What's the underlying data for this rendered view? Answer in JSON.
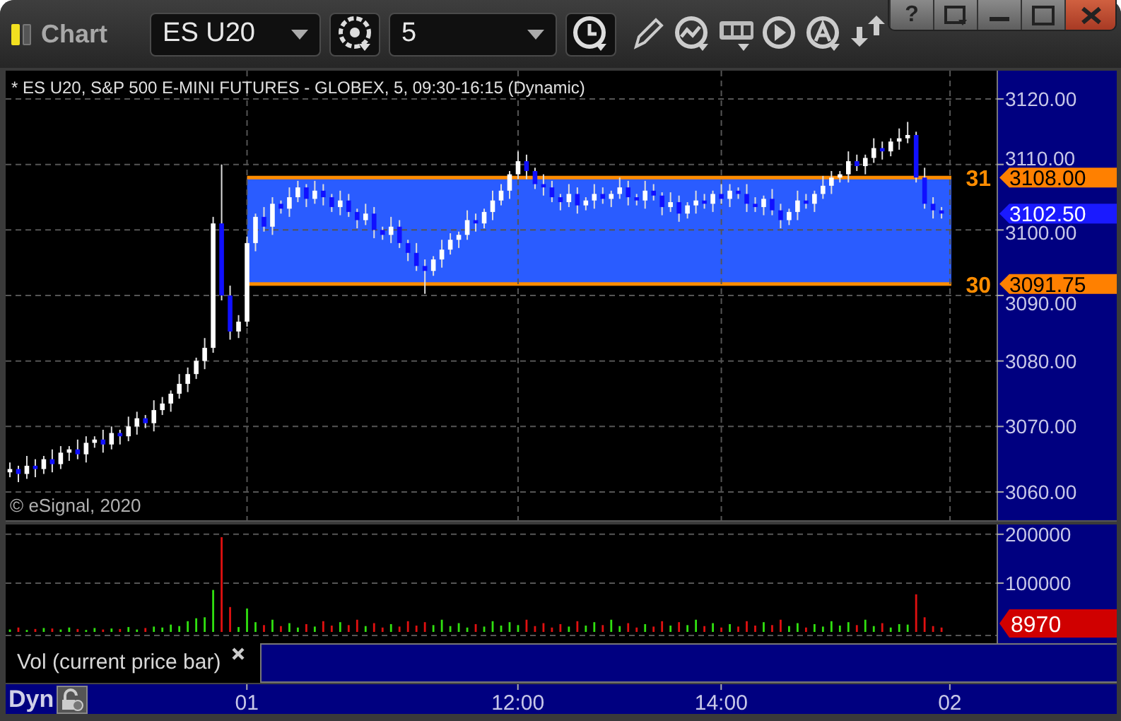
{
  "window": {
    "title": "Chart",
    "help_button": "?"
  },
  "toolbar": {
    "symbol": "ES U20",
    "interval": "5"
  },
  "price_pane": {
    "legend": "* ES U20, S&P 500 E-MINI FUTURES - GLOBEX, 5, 09:30-16:15 (Dynamic)",
    "copyright": "© eSignal, 2020",
    "band": {
      "upper_label": "31",
      "upper_price": "3108.00",
      "lower_label": "30",
      "lower_price": "3091.75"
    },
    "last_price": "3102.50",
    "chart_data": {
      "type": "candlestick",
      "grid": true,
      "categories": [
        null,
        null,
        null,
        null,
        null,
        null,
        null,
        null,
        null,
        null,
        null,
        null,
        null,
        null,
        null,
        null,
        null,
        null,
        null,
        null,
        null,
        null,
        null,
        null,
        null,
        null,
        null,
        null,
        null,
        null,
        null,
        null,
        null,
        null,
        null,
        null,
        null,
        null,
        null,
        null,
        null,
        null,
        null,
        null,
        null,
        null,
        null,
        null,
        null,
        null,
        null,
        null,
        null,
        null,
        null,
        null,
        null,
        null,
        null,
        null,
        null,
        null,
        null,
        null,
        null,
        null,
        null,
        null,
        null,
        null,
        null,
        null,
        null,
        null,
        null,
        null,
        null,
        null,
        null,
        null,
        null,
        null,
        null,
        null,
        null,
        null,
        null,
        null,
        null,
        null,
        null,
        null,
        null,
        null,
        null,
        null,
        null,
        null,
        null,
        null,
        null,
        null,
        null,
        null,
        null,
        null,
        null,
        null,
        null,
        null,
        null,
        null,
        null,
        null,
        null,
        null,
        null
      ],
      "ohlc": [
        [
          3063,
          3064.5,
          3062.25,
          3063.5
        ],
        [
          3063.5,
          3064,
          3061.5,
          3062.75
        ],
        [
          3062.75,
          3065.5,
          3062,
          3064
        ],
        [
          3064,
          3065,
          3062.25,
          3063.5
        ],
        [
          3063.5,
          3065.5,
          3062.75,
          3065
        ],
        [
          3065,
          3066.5,
          3063,
          3064.25
        ],
        [
          3064.25,
          3067,
          3063.5,
          3066
        ],
        [
          3066,
          3067,
          3064.75,
          3066.5
        ],
        [
          3066.5,
          3068,
          3065,
          3065.75
        ],
        [
          3065.75,
          3068.5,
          3064.5,
          3067.5
        ],
        [
          3067.5,
          3068.5,
          3066.75,
          3068
        ],
        [
          3068,
          3069.5,
          3066,
          3067.25
        ],
        [
          3067.25,
          3070,
          3066.5,
          3069
        ],
        [
          3069,
          3069.5,
          3067.25,
          3068.5
        ],
        [
          3068.5,
          3071.5,
          3067.75,
          3070
        ],
        [
          3070,
          3072.25,
          3068.75,
          3071.25
        ],
        [
          3071.25,
          3071.75,
          3069.75,
          3070.5
        ],
        [
          3070.5,
          3074,
          3069.25,
          3072.5
        ],
        [
          3072.5,
          3074.5,
          3071.75,
          3073.5
        ],
        [
          3073.5,
          3075.5,
          3072.25,
          3075
        ],
        [
          3075,
          3078,
          3074.25,
          3076.5
        ],
        [
          3076.5,
          3079,
          3075.25,
          3078
        ],
        [
          3078,
          3080.5,
          3077.25,
          3080
        ],
        [
          3080,
          3083.5,
          3078.75,
          3082
        ],
        [
          3082,
          3102,
          3081.25,
          3101
        ],
        [
          3101,
          3110,
          3089.25,
          3090
        ],
        [
          3090,
          3091.5,
          3083.25,
          3084.5
        ],
        [
          3084.5,
          3087,
          3083.5,
          3086
        ],
        [
          3086,
          3099,
          3085.25,
          3098
        ],
        [
          3098,
          3102.5,
          3096.75,
          3102
        ],
        [
          3102,
          3103.5,
          3099.75,
          3100.5
        ],
        [
          3100.5,
          3105,
          3099.25,
          3104
        ],
        [
          3104,
          3104.5,
          3102.5,
          3103.25
        ],
        [
          3103.25,
          3106.5,
          3102,
          3105
        ],
        [
          3105,
          3107.5,
          3104.25,
          3106.5
        ],
        [
          3106.5,
          3107,
          3103.5,
          3104.75
        ],
        [
          3104.75,
          3107.5,
          3104,
          3106
        ],
        [
          3106,
          3107,
          3103.75,
          3105
        ],
        [
          3105,
          3105.5,
          3102.75,
          3103.5
        ],
        [
          3103.5,
          3106,
          3102.25,
          3104.5
        ],
        [
          3104.5,
          3105.5,
          3102,
          3102.75
        ],
        [
          3102.75,
          3103.25,
          3100.25,
          3101.5
        ],
        [
          3101.5,
          3104,
          3100.75,
          3102.5
        ],
        [
          3102.5,
          3103.5,
          3098.75,
          3100
        ],
        [
          3100,
          3100.5,
          3098.5,
          3099.25
        ],
        [
          3099.25,
          3102,
          3098,
          3100.5
        ],
        [
          3100.5,
          3101.5,
          3097.25,
          3098
        ],
        [
          3098,
          3098.5,
          3095.25,
          3096.5
        ],
        [
          3096.5,
          3098,
          3093.75,
          3094.5
        ],
        [
          3094.5,
          3095.5,
          3090.25,
          3093.75
        ],
        [
          3093.75,
          3096,
          3093,
          3095.5
        ],
        [
          3095.5,
          3098.5,
          3094.25,
          3097
        ],
        [
          3097,
          3099.5,
          3096.25,
          3098.5
        ],
        [
          3098.5,
          3099.75,
          3097.25,
          3099.25
        ],
        [
          3099.25,
          3103,
          3098.5,
          3101.5
        ],
        [
          3101.5,
          3102.5,
          3099.75,
          3101
        ],
        [
          3101,
          3103.25,
          3100.25,
          3102.75
        ],
        [
          3102.75,
          3106,
          3101.5,
          3104.5
        ],
        [
          3104.5,
          3107,
          3103.75,
          3106
        ],
        [
          3106,
          3109,
          3104.75,
          3108.5
        ],
        [
          3108.5,
          3112,
          3107.75,
          3110.5
        ],
        [
          3110.5,
          3111.5,
          3107.75,
          3109
        ],
        [
          3109,
          3109.5,
          3106.25,
          3107
        ],
        [
          3107,
          3108.5,
          3105.25,
          3106.5
        ],
        [
          3106.5,
          3107.5,
          3104.25,
          3105
        ],
        [
          3105,
          3105.5,
          3103,
          3104.25
        ],
        [
          3104.25,
          3107,
          3103.5,
          3105.5
        ],
        [
          3105.5,
          3106.5,
          3102.5,
          3103.75
        ],
        [
          3103.75,
          3105,
          3103,
          3104.5
        ],
        [
          3104.5,
          3107,
          3103.25,
          3105.5
        ],
        [
          3105.5,
          3106.5,
          3104,
          3104.75
        ],
        [
          3104.75,
          3106,
          3103.5,
          3105.5
        ],
        [
          3105.5,
          3108,
          3104.75,
          3106.5
        ],
        [
          3106.5,
          3107.5,
          3103.75,
          3105
        ],
        [
          3105,
          3105.5,
          3103.75,
          3104.5
        ],
        [
          3104.5,
          3107.5,
          3103.25,
          3106
        ],
        [
          3106,
          3107,
          3104.5,
          3105.25
        ],
        [
          3105.25,
          3105.75,
          3102.25,
          3103.5
        ],
        [
          3103.5,
          3105.75,
          3102.75,
          3104.25
        ],
        [
          3104.25,
          3105.25,
          3101.25,
          3102.5
        ],
        [
          3102.5,
          3104.25,
          3101.75,
          3103.75
        ],
        [
          3103.75,
          3106,
          3102.5,
          3104.5
        ],
        [
          3104.5,
          3105.5,
          3103.25,
          3104
        ],
        [
          3104,
          3106,
          3102.75,
          3105.5
        ],
        [
          3105.5,
          3107,
          3104,
          3104.75
        ],
        [
          3104.75,
          3107,
          3103.5,
          3106
        ],
        [
          3106,
          3106.5,
          3104.75,
          3105.5
        ],
        [
          3105.5,
          3107,
          3102.75,
          3104
        ],
        [
          3104,
          3105,
          3102.75,
          3103.5
        ],
        [
          3103.5,
          3105.25,
          3102.25,
          3104.75
        ],
        [
          3104.75,
          3106.25,
          3102.25,
          3103
        ],
        [
          3103,
          3104,
          3100.25,
          3101.5
        ],
        [
          3101.5,
          3103.25,
          3100.75,
          3102.75
        ],
        [
          3102.75,
          3106,
          3101.5,
          3104.5
        ],
        [
          3104.5,
          3105.5,
          3103.25,
          3104
        ],
        [
          3104,
          3106,
          3102.75,
          3105.5
        ],
        [
          3105.5,
          3108.25,
          3104.75,
          3106.75
        ],
        [
          3106.75,
          3109,
          3105.5,
          3108
        ],
        [
          3108,
          3109,
          3107.25,
          3108.5
        ],
        [
          3108.5,
          3112,
          3107.25,
          3110.5
        ],
        [
          3110.5,
          3111.5,
          3109,
          3109.75
        ],
        [
          3109.75,
          3111.5,
          3108.5,
          3111
        ],
        [
          3111,
          3114,
          3110.25,
          3112.5
        ],
        [
          3112.5,
          3113.5,
          3110.75,
          3112
        ],
        [
          3112,
          3114,
          3111.25,
          3113.5
        ],
        [
          3113.5,
          3115.5,
          3112.25,
          3114
        ],
        [
          3114,
          3116.5,
          3113.25,
          3114.5
        ],
        [
          3114.5,
          3115,
          3107.25,
          3108
        ],
        [
          3108,
          3109.5,
          3103.25,
          3104
        ],
        [
          3104,
          3105,
          3101.75,
          3103
        ],
        [
          3103,
          3103.5,
          3101.75,
          3102.5
        ],
        null,
        null,
        null,
        null,
        null,
        null
      ],
      "ylim": [
        3055.68,
        3124.32
      ],
      "yticks": [
        {
          "value": 3120,
          "label": "3120.00"
        },
        {
          "value": 3110,
          "label": "3110.00"
        },
        {
          "value": 3100,
          "label": "3100.00"
        },
        {
          "value": 3090,
          "label": "3090.00"
        },
        {
          "value": 3080,
          "label": "3080.00"
        },
        {
          "value": 3070,
          "label": "3070.00"
        },
        {
          "value": 3060,
          "label": "3060.00"
        }
      ]
    }
  },
  "volume_pane": {
    "study": "Vol (current price bar)",
    "last_volume": "8970",
    "chart_data": {
      "type": "bar",
      "grid": true,
      "categories": [
        null,
        null,
        null,
        null,
        null,
        null,
        null,
        null,
        null,
        null,
        null,
        null,
        null,
        null,
        null,
        null,
        null,
        null,
        null,
        null,
        null,
        null,
        null,
        null,
        null,
        null,
        null,
        null,
        "01",
        null,
        null,
        null,
        null,
        null,
        null,
        null,
        null,
        null,
        null,
        null,
        null,
        null,
        null,
        null,
        null,
        null,
        null,
        null,
        null,
        null,
        null,
        null,
        null,
        null,
        null,
        null,
        null,
        null,
        null,
        null,
        "12:00",
        null,
        null,
        null,
        null,
        null,
        null,
        null,
        null,
        null,
        null,
        null,
        null,
        null,
        null,
        null,
        null,
        null,
        null,
        null,
        null,
        null,
        null,
        null,
        "14:00",
        null,
        null,
        null,
        null,
        null,
        null,
        null,
        null,
        null,
        null,
        null,
        null,
        null,
        null,
        null,
        null,
        null,
        null,
        null,
        null,
        null,
        null,
        null,
        null,
        null,
        null,
        "02",
        null,
        null,
        null,
        null,
        null
      ],
      "values": [
        5000,
        9000,
        4000,
        6000,
        8000,
        7000,
        5000,
        9000,
        6000,
        4000,
        8000,
        5000,
        7000,
        6000,
        10000,
        5000,
        8000,
        11000,
        9000,
        15000,
        12000,
        22000,
        28000,
        30000,
        86000,
        194000,
        51000,
        10000,
        48000,
        20000,
        14000,
        25000,
        12000,
        18000,
        9000,
        16000,
        11000,
        22000,
        13000,
        20000,
        14000,
        25000,
        12000,
        18000,
        9000,
        16000,
        11000,
        22000,
        13000,
        20000,
        14000,
        25000,
        12000,
        18000,
        9000,
        16000,
        11000,
        22000,
        13000,
        20000,
        14000,
        25000,
        12000,
        18000,
        9000,
        16000,
        11000,
        22000,
        13000,
        20000,
        14000,
        25000,
        12000,
        18000,
        9000,
        16000,
        11000,
        22000,
        13000,
        20000,
        14000,
        25000,
        12000,
        18000,
        9000,
        16000,
        11000,
        22000,
        13000,
        20000,
        14000,
        25000,
        12000,
        18000,
        9000,
        16000,
        11000,
        22000,
        13000,
        20000,
        14000,
        25000,
        12000,
        18000,
        9000,
        16000,
        15000,
        77000,
        30000,
        12000,
        9000,
        null,
        null,
        null,
        null,
        null,
        null
      ],
      "ylim": [
        0,
        220000
      ],
      "yticks": [
        {
          "value": 200000,
          "label": "200000"
        },
        {
          "value": 100000,
          "label": "100000"
        }
      ]
    }
  },
  "time_axis": {
    "mode": "Dyn"
  }
}
